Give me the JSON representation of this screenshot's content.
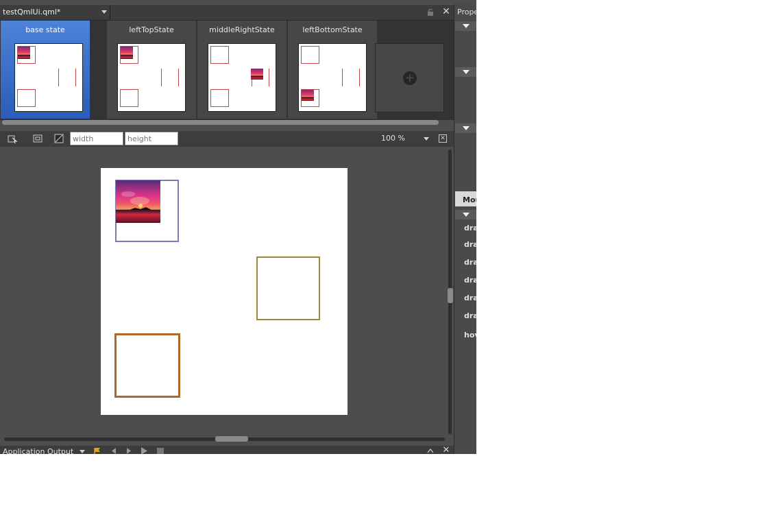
{
  "document": {
    "title": "testQmlUi.qml*"
  },
  "states": [
    {
      "label": "base state",
      "active": true
    },
    {
      "label": "leftTopState",
      "active": false
    },
    {
      "label": "middleRightState",
      "active": false
    },
    {
      "label": "leftBottomState",
      "active": false
    }
  ],
  "toolbar": {
    "width_placeholder": "width",
    "height_placeholder": "height",
    "zoom": "100 %"
  },
  "output": {
    "label": "Application Output"
  },
  "properties": {
    "title": "Prope",
    "mouse_tab": "Mou",
    "items": [
      "dra",
      "dra",
      "dra",
      "dra",
      "dra",
      "dra",
      "hov"
    ]
  },
  "colors": {
    "accent": "#2b5cb8",
    "panel": "#4d4d4d",
    "thumb_border": "#c0454a",
    "box_olive": "#9c8a3a",
    "box_brown": "#b0672a",
    "box_blue": "#7a7ab8"
  },
  "icons": [
    "lock-icon",
    "close-icon",
    "add-icon",
    "select-tool-icon",
    "frame-icon",
    "anchor-icon",
    "fit-icon",
    "flag-icon",
    "back-arrow-icon",
    "forward-arrow-icon",
    "run-icon",
    "stop-icon",
    "chevron-up-icon"
  ]
}
